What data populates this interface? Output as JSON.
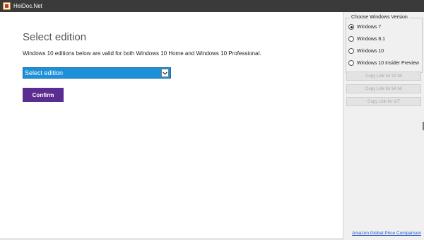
{
  "window": {
    "title": "HeiDoc.Net",
    "icon": "heidoc-app-icon"
  },
  "main": {
    "heading": "Select edition",
    "description": "Windows 10 editions below are valid for both Windows 10 Home and Windows 10 Professional.",
    "select": {
      "value": "Select edition",
      "icon": "chevron-down-icon"
    },
    "confirm_label": "Confirm"
  },
  "sidebar": {
    "group_title": "Choose Windows Version",
    "options": [
      {
        "label": "Windows 7",
        "checked": true
      },
      {
        "label": "Windows 8.1",
        "checked": false
      },
      {
        "label": "Windows 10",
        "checked": false
      },
      {
        "label": "Windows 10 Insider Preview",
        "checked": false
      }
    ],
    "buttons": [
      {
        "label": "Copy Link for 32 bit"
      },
      {
        "label": "Copy Link for 64 bit"
      },
      {
        "label": "Copy Link for IoT"
      }
    ],
    "link": "Amazon Global Price Comparison"
  },
  "colors": {
    "titlebar": "#3a3a3a",
    "select_bg": "#1e90d8",
    "confirm_bg": "#5c2d91",
    "sidebar_bg": "#f0f0f0",
    "link": "#1a55c9"
  }
}
